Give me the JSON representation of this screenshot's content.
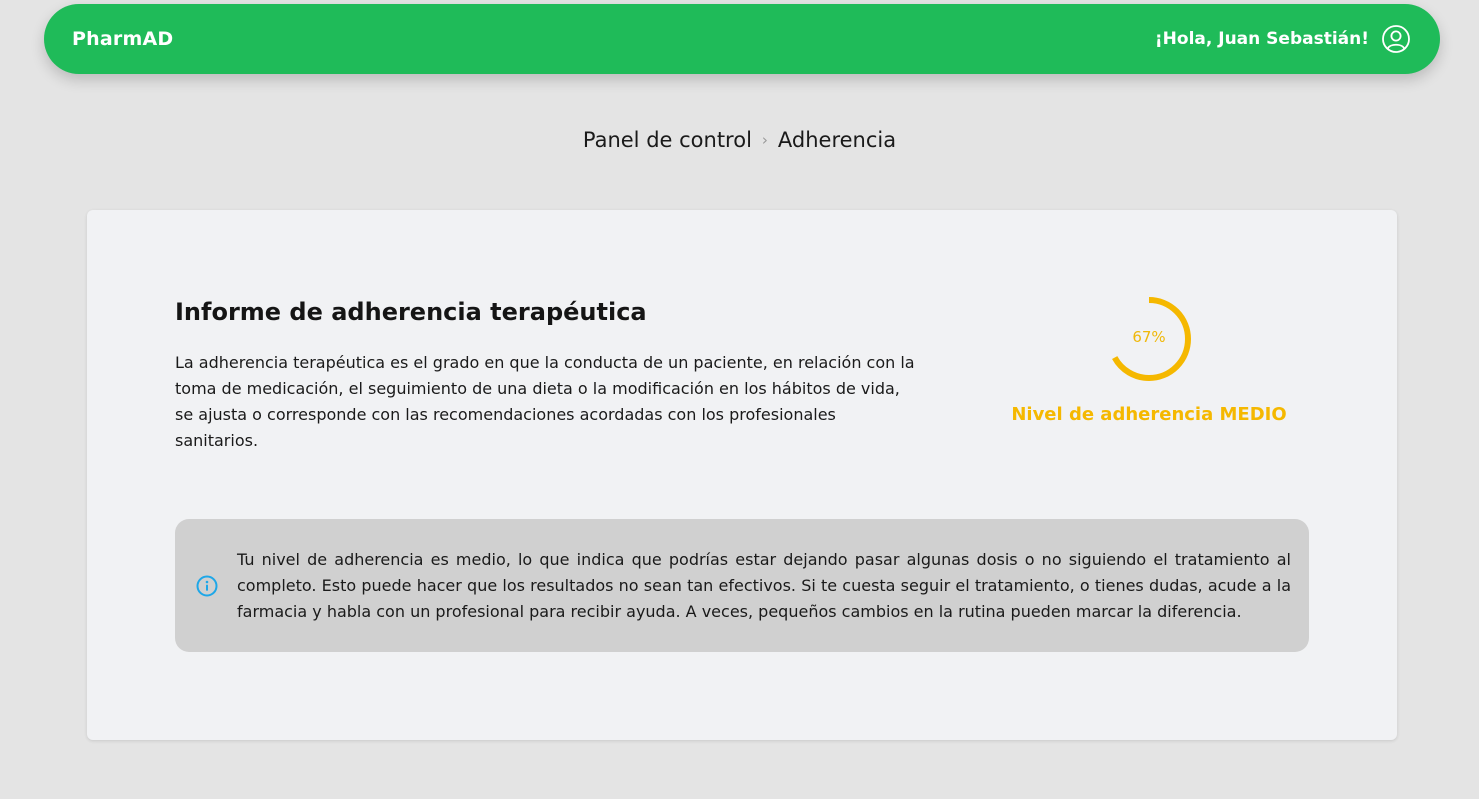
{
  "header": {
    "brand": "PharmAD",
    "greeting": "¡Hola, Juan Sebastián!",
    "user_icon": "user-circle-icon"
  },
  "breadcrumb": {
    "items": [
      "Panel de control",
      "Adherencia"
    ],
    "separator_icon": "chevron-right-icon"
  },
  "report": {
    "title": "Informe de adherencia terapéutica",
    "description": "La adherencia terapéutica es el grado en que la conducta de un paciente, en relación con la toma de medicación, el seguimiento de una dieta o la modificación en los hábitos de vida, se ajusta o corresponde con las recomendaciones acordadas con los profesionales sanitarios."
  },
  "gauge": {
    "value": 67,
    "value_label": "67%",
    "level_label": "Nivel de adherencia MEDIO",
    "color": "#f5b800"
  },
  "alert": {
    "icon": "info-icon",
    "text": "Tu nivel de adherencia es medio, lo que indica que podrías estar dejando pasar algunas dosis o no siguiendo el tratamiento al completo. Esto puede hacer que los resultados no sean tan efectivos. Si te cuesta seguir el tratamiento, o tienes dudas, acude a la farmacia y habla con un profesional para recibir ayuda. A veces, pequeños cambios en la rutina pueden marcar la diferencia.",
    "icon_color": "#1ea7e8"
  },
  "colors": {
    "brand_green": "#1fbb59",
    "background": "#e4e4e4",
    "card": "#f1f2f4",
    "alert_bg": "#d0d0d0"
  }
}
